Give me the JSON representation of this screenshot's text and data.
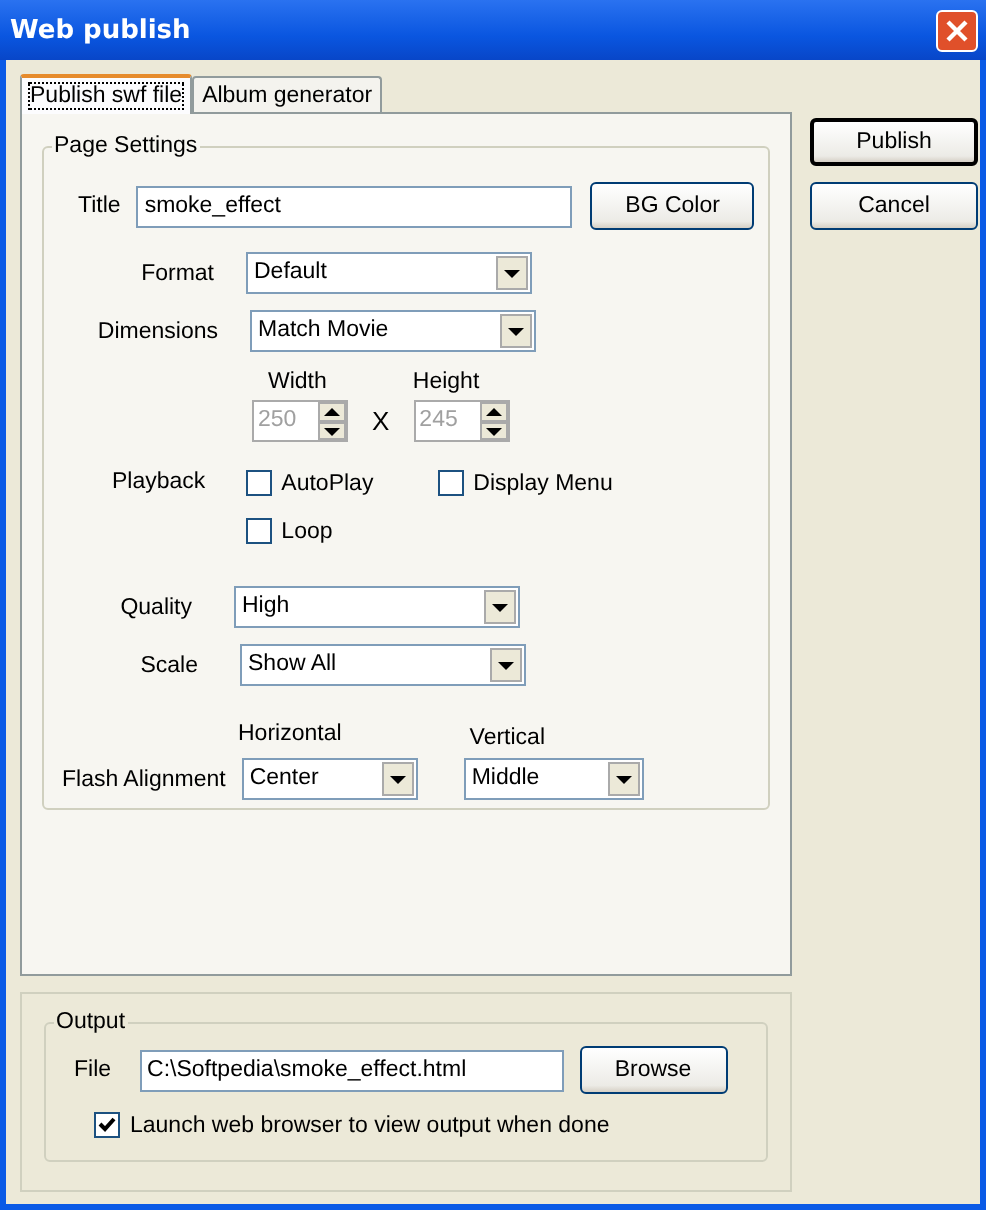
{
  "window": {
    "title": "Web publish"
  },
  "tabs": [
    {
      "label": "Publish swf file",
      "selected": true
    },
    {
      "label": "Album generator",
      "selected": false
    }
  ],
  "buttons": [
    {
      "label": "Publish",
      "default": true
    },
    {
      "label": "Cancel",
      "default": false
    }
  ],
  "page_settings": {
    "label": "Page Settings",
    "title": {
      "label": "Title",
      "value": "smoke_effect"
    },
    "bg_color_button": "BG Color",
    "format": {
      "label": "Format",
      "value": "Default"
    },
    "dimensions": {
      "label": "Dimensions",
      "value": "Match Movie"
    },
    "width": {
      "label": "Width",
      "value": "250",
      "disabled": true
    },
    "times": "X",
    "height": {
      "label": "Height",
      "value": "245",
      "disabled": true
    },
    "playback": {
      "label": "Playback",
      "options": [
        {
          "label": "AutoPlay",
          "checked": false
        },
        {
          "label": "Display Menu",
          "checked": false
        },
        {
          "label": "Loop",
          "checked": false
        }
      ]
    },
    "quality": {
      "label": "Quality",
      "value": "High"
    },
    "scale": {
      "label": "Scale",
      "value": "Show All"
    },
    "alignment": {
      "label": "Flash Alignment",
      "horizontal": {
        "label": "Horizontal",
        "value": "Center"
      },
      "vertical": {
        "label": "Vertical",
        "value": "Middle"
      }
    }
  },
  "output": {
    "label": "Output",
    "file": {
      "label": "File",
      "value": "C:\\Softpedia\\smoke_effect.html"
    },
    "browse_button": "Browse",
    "launch": {
      "label": "Launch web browser to view output when done",
      "checked": true
    }
  }
}
